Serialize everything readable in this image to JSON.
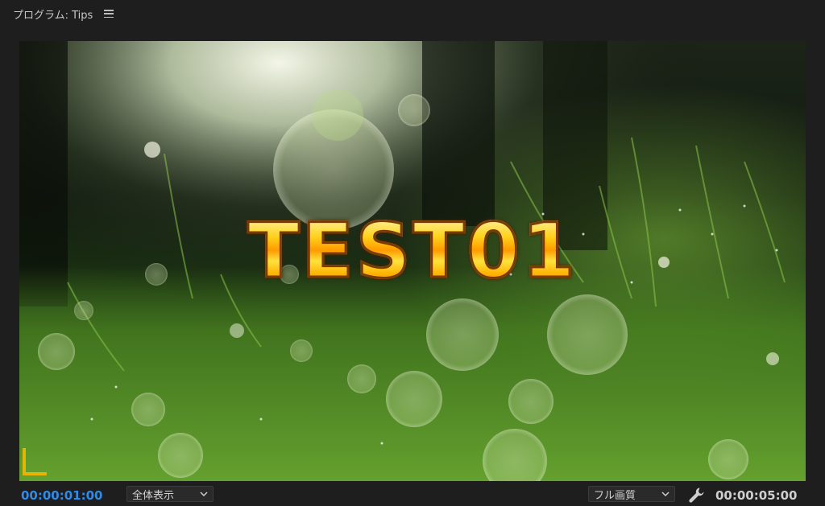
{
  "panel": {
    "title": "プログラム: Tips",
    "menu_icon": "hamburger-menu-icon"
  },
  "viewer": {
    "overlay_title": "TEST01",
    "overlay_title_colors": [
      "#fff6b8",
      "#ffd21a",
      "#ff9a00",
      "#7a3a00"
    ],
    "safe_margin_color": "#e8b400"
  },
  "footer": {
    "current_timecode": "00:00:01:00",
    "current_timecode_color": "#2d8ceb",
    "zoom_select": "全体表示",
    "quality_select": "フル画質",
    "settings_icon": "wrench-icon",
    "duration_timecode": "00:00:05:00"
  }
}
